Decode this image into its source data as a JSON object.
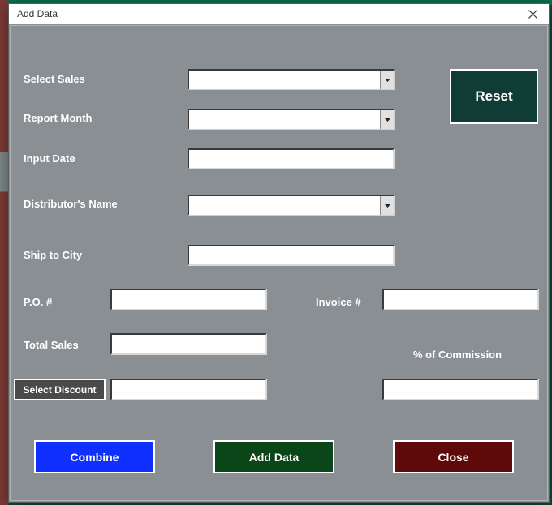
{
  "dialog": {
    "title": "Add Data"
  },
  "labels": {
    "select_sales": "Select Sales",
    "report_month": "Report Month",
    "input_date": "Input Date",
    "distributor": "Distributor's Name",
    "ship_city": "Ship to City",
    "po_num": "P.O. #",
    "invoice_num": "Invoice #",
    "total_sales": "Total Sales",
    "pct_commission": "% of Commission"
  },
  "buttons": {
    "reset": "Reset",
    "select_discount": "Select Discount",
    "combine": "Combine",
    "add_data": "Add Data",
    "close": "Close"
  },
  "fields": {
    "select_sales": "",
    "report_month": "",
    "input_date": "",
    "distributor": "",
    "ship_city": "",
    "po_num": "",
    "invoice_num": "",
    "total_sales": "",
    "discount": "",
    "commission_pct": ""
  }
}
